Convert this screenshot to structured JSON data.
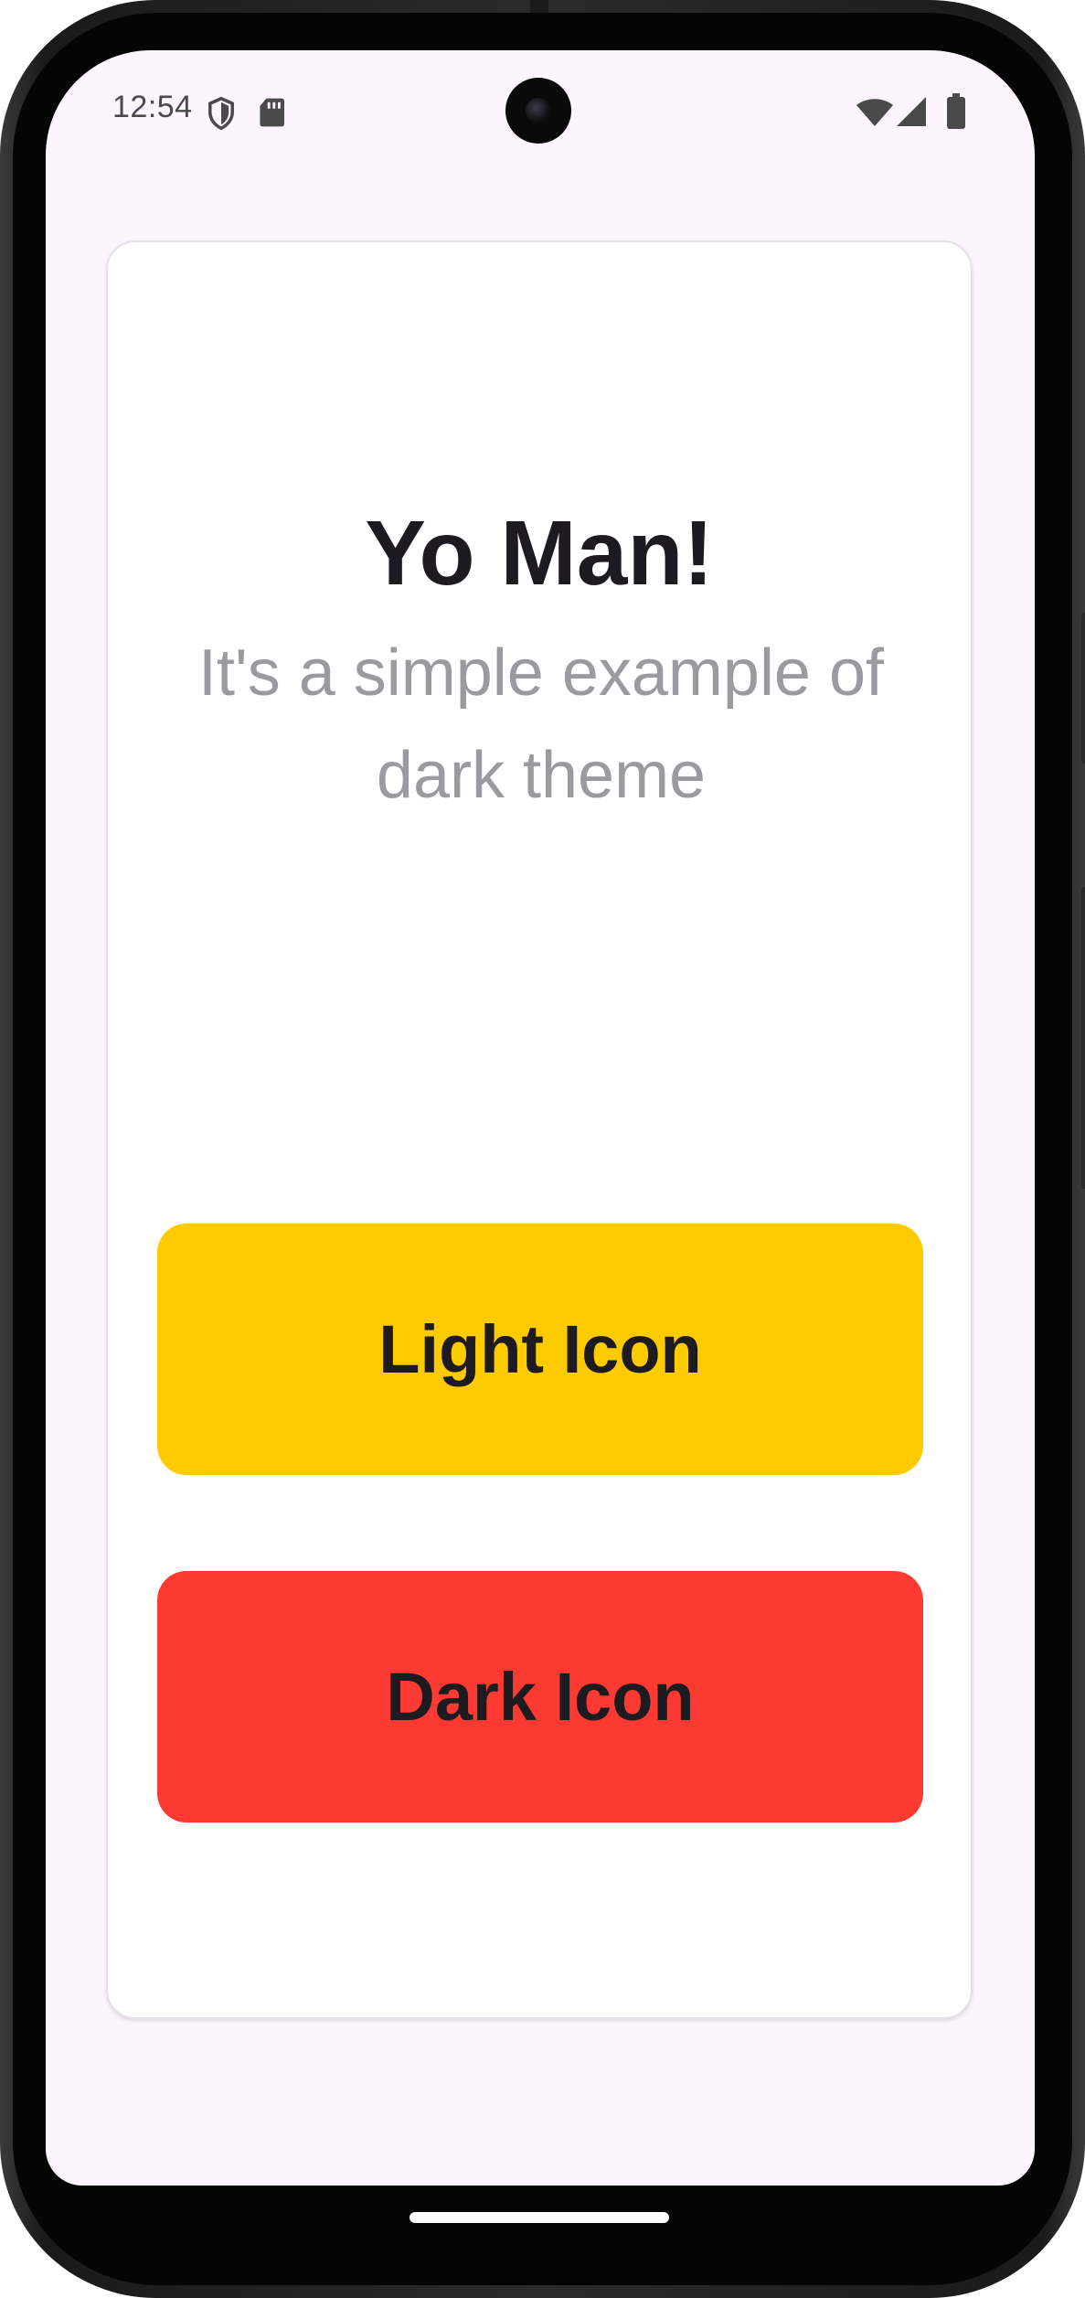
{
  "status_bar": {
    "time": "12:54",
    "icons": [
      "shield-icon",
      "sd-card-icon",
      "wifi-icon",
      "signal-icon",
      "battery-icon"
    ]
  },
  "card": {
    "title": "Yo Man!",
    "subtitle": "It's a simple example of dark theme"
  },
  "buttons": {
    "light_label": "Light Icon",
    "dark_label": "Dark Icon"
  },
  "colors": {
    "background": "#fcf5fd",
    "card": "#ffffff",
    "light_button": "#fdcb00",
    "dark_button": "#fd3a31",
    "text_primary": "#1d1b20",
    "text_secondary": "#9a9a9f"
  }
}
